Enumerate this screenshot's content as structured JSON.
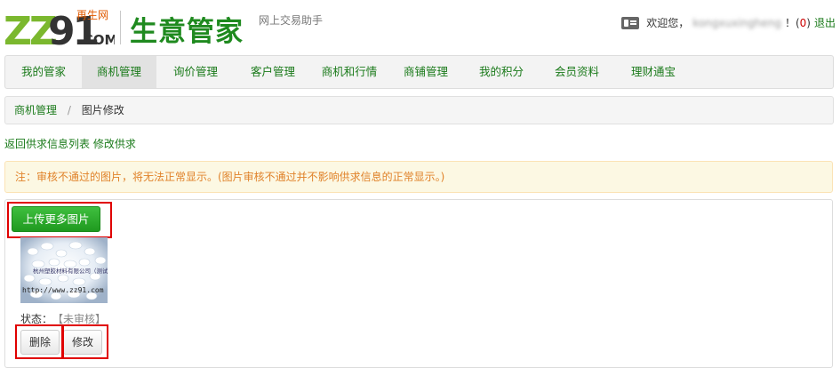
{
  "header": {
    "logo_brand": "ZZ91.COM",
    "logo_tagline": "再生网",
    "app_title": "生意管家",
    "app_subtitle": "网上交易助手",
    "welcome": "欢迎您，",
    "username": "kongxuxingheng",
    "msg_open": "！(",
    "msg_count": "0",
    "msg_close": ")",
    "logout": "退出"
  },
  "nav": {
    "items": [
      {
        "label": "我的管家"
      },
      {
        "label": "商机管理"
      },
      {
        "label": "询价管理"
      },
      {
        "label": "客户管理"
      },
      {
        "label": "商机和行情"
      },
      {
        "label": "商铺管理"
      },
      {
        "label": "我的积分"
      },
      {
        "label": "会员资料"
      },
      {
        "label": "理财通宝"
      }
    ],
    "active_index": 1
  },
  "breadcrumb": {
    "root": "商机管理",
    "separator": "/",
    "current": "图片修改"
  },
  "links": {
    "back": "返回供求信息列表",
    "edit": "修改供求"
  },
  "notice": "注：审核不通过的图片，将无法正常显示。(图片审核不通过并不影响供求信息的正常显示。)",
  "upload_button": "上传更多图片",
  "image": {
    "watermark_company": "杭州塑胶材料有限公司（测试）",
    "watermark_url": "http://www.zz91.com",
    "status_label": "状态：",
    "status_value": "【未审核】",
    "delete_button": "删除",
    "edit_button": "修改"
  },
  "colors": {
    "brand_green": "#1f8a1f",
    "link_green": "#1a7a1a",
    "notice_text": "#e0822a",
    "notice_bg": "#fcf8e3",
    "highlight_red": "#e00000"
  }
}
